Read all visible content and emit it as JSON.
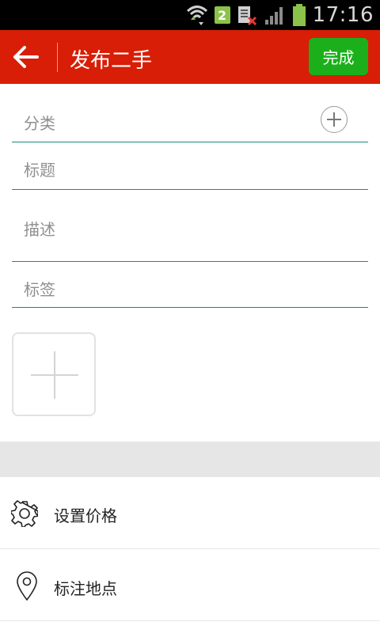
{
  "status_bar": {
    "time": "17:16",
    "sim_badge": "2",
    "icons": [
      "wifi-icon",
      "sim-badge",
      "no-sim-icon",
      "signal-icon",
      "battery-icon"
    ]
  },
  "header": {
    "title": "发布二手",
    "done_label": "完成",
    "bg_color": "#d81e06",
    "done_color": "#1bb01b"
  },
  "form": {
    "category_placeholder": "分类",
    "title_placeholder": "标题",
    "description_placeholder": "描述",
    "tags_placeholder": "标签"
  },
  "options": {
    "set_price_label": "设置价格",
    "mark_location_label": "标注地点"
  }
}
